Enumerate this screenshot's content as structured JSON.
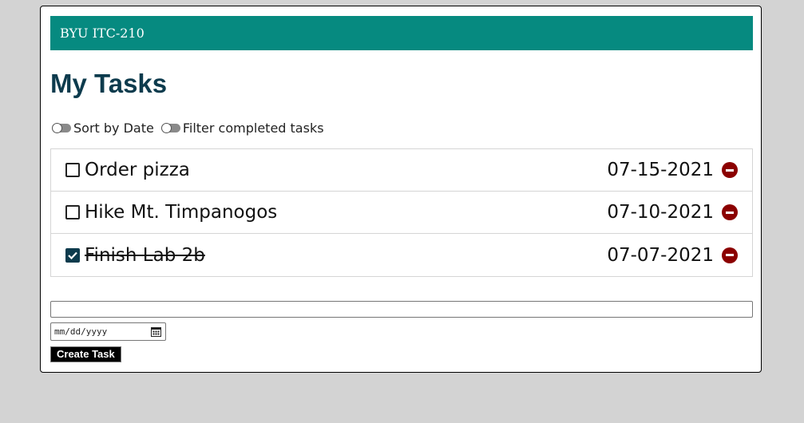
{
  "banner": {
    "title": "BYU ITC-210"
  },
  "page": {
    "title": "My Tasks"
  },
  "toggles": {
    "sort_by_date": {
      "label": "Sort by Date",
      "on": false
    },
    "filter_completed": {
      "label": "Filter completed tasks",
      "on": false
    }
  },
  "tasks": [
    {
      "name": "Order pizza",
      "date": "07-15-2021",
      "completed": false
    },
    {
      "name": "Hike Mt. Timpanogos",
      "date": "07-10-2021",
      "completed": false
    },
    {
      "name": "Finish Lab 2b",
      "date": "07-07-2021",
      "completed": true
    }
  ],
  "form": {
    "task_value": "",
    "date_placeholder": "mm/dd/yyyy",
    "submit_label": "Create Task"
  },
  "colors": {
    "banner": "#068a80",
    "title": "#0d3b4d",
    "remove": "#8b0000",
    "page_background": "#d3d3d3"
  },
  "icons": {
    "remove": "minus-circle-icon",
    "calendar": "calendar-icon",
    "check": "checkmark-icon"
  }
}
